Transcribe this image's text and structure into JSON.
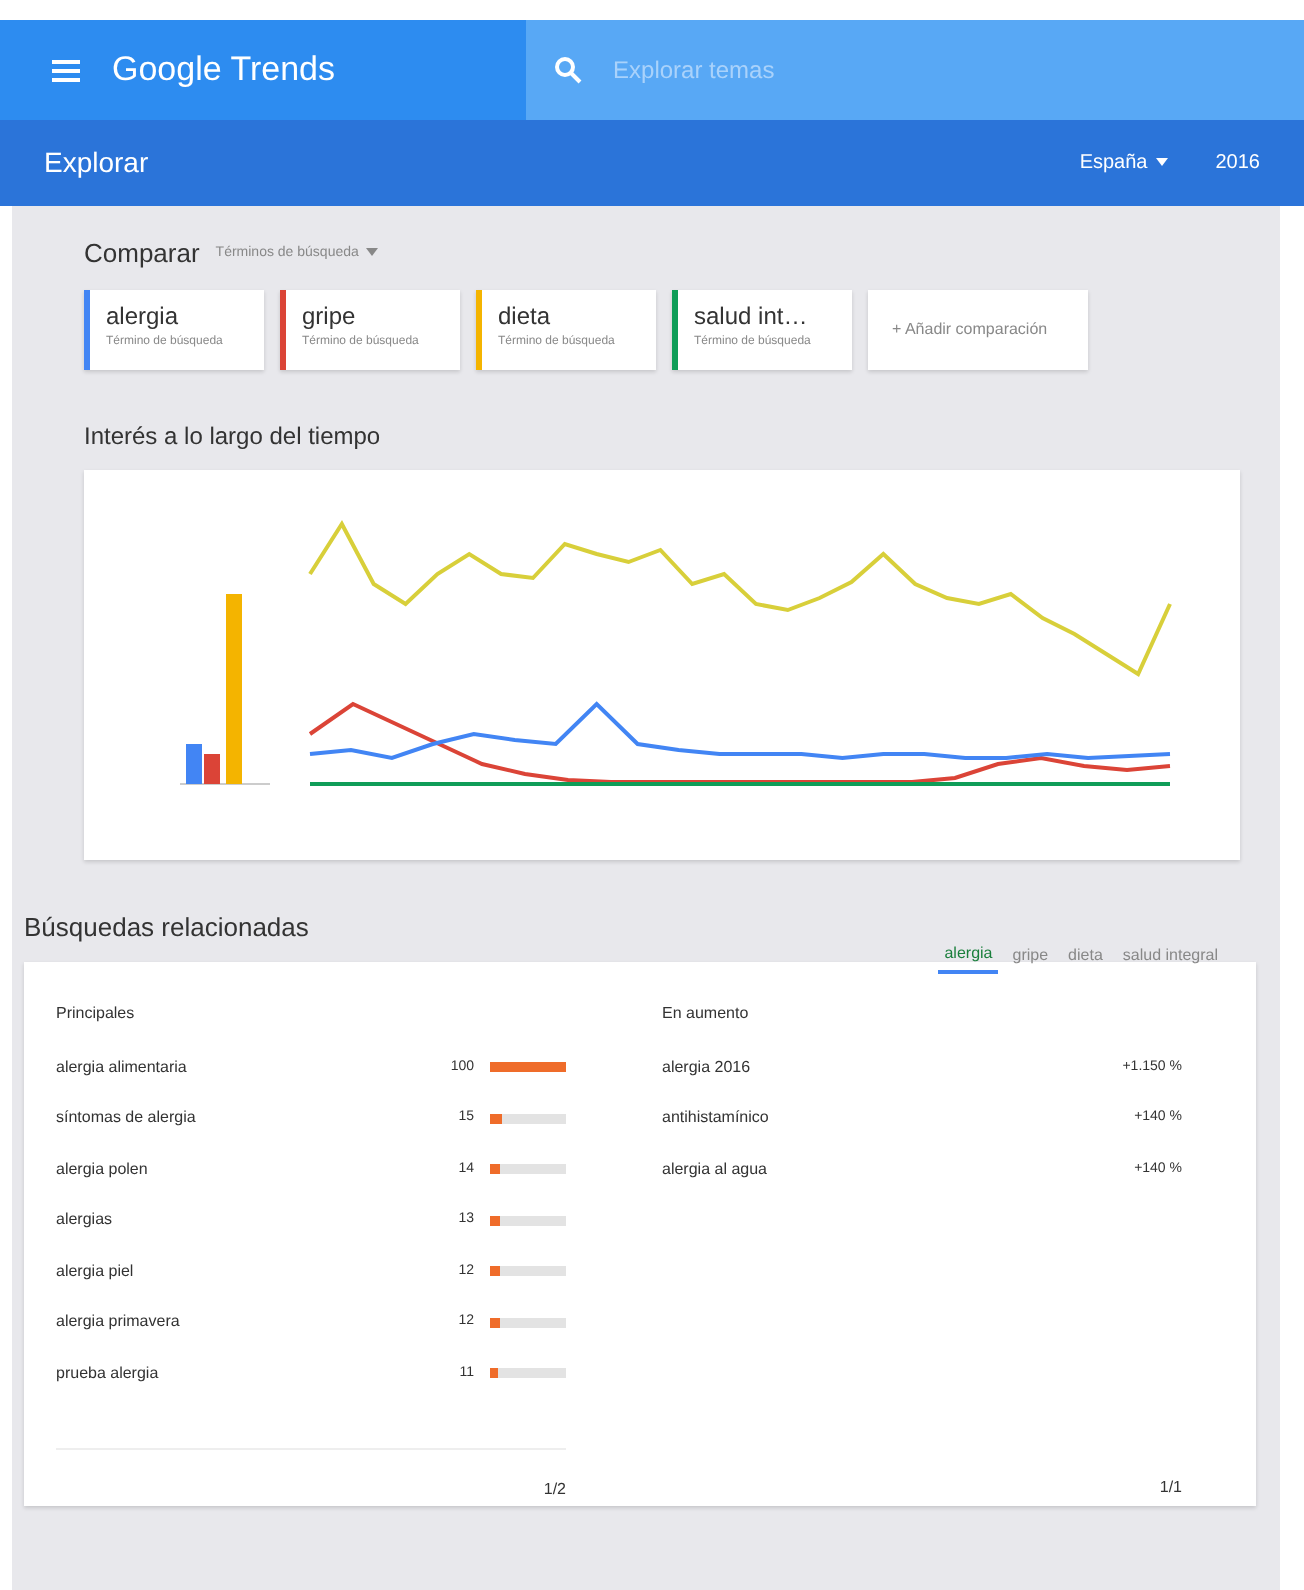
{
  "header": {
    "logo": "Google Trends",
    "search": {
      "placeholder": "Explorar temas"
    }
  },
  "subheader": {
    "title": "Explorar",
    "region": "España",
    "period": "2016"
  },
  "compare": {
    "label": "Comparar",
    "selector": "Términos de búsqueda",
    "terms": [
      {
        "name": "alergia",
        "type": "Término de búsqueda",
        "color": "#4285f4"
      },
      {
        "name": "gripe",
        "type": "Término de búsqueda",
        "color": "#db4437"
      },
      {
        "name": "dieta",
        "type": "Término de búsqueda",
        "color": "#f4b400"
      },
      {
        "name": "salud int…",
        "type": "Término de búsqueda",
        "color": "#0f9d58"
      }
    ],
    "add": "+ Añadir comparación"
  },
  "interest": {
    "title": "Interés a lo largo del tiempo",
    "kind": "picture"
  },
  "related": {
    "title": "Búsquedas relacionadas",
    "tabs": [
      {
        "label": "alergia",
        "selected": true
      },
      {
        "label": "gripe",
        "selected": false
      },
      {
        "label": "dieta",
        "selected": false
      },
      {
        "label": "salud integral",
        "selected": false
      }
    ],
    "top": {
      "heading": "Principales",
      "rows": [
        {
          "query": "alergia alimentaria",
          "value": "100",
          "level": 1.0
        },
        {
          "query": "síntomas de alergia",
          "value": "15",
          "level": 0.15
        },
        {
          "query": "alergia polen",
          "value": "14",
          "level": 0.14
        },
        {
          "query": "alergias",
          "value": "13",
          "level": 0.13
        },
        {
          "query": "alergia piel",
          "value": "12",
          "level": 0.12
        },
        {
          "query": "alergia primavera",
          "value": "12",
          "level": 0.12
        },
        {
          "query": "prueba alergia",
          "value": "11",
          "level": 0.11
        }
      ],
      "pager": "1/2"
    },
    "rising": {
      "heading": "En aumento",
      "rows": [
        {
          "query": "alergia 2016",
          "value": "+1.150 %"
        },
        {
          "query": "antihistamínico",
          "value": "+140 %"
        },
        {
          "query": "alergia al agua",
          "value": "+140 %"
        }
      ],
      "pager": "1/1"
    }
  }
}
